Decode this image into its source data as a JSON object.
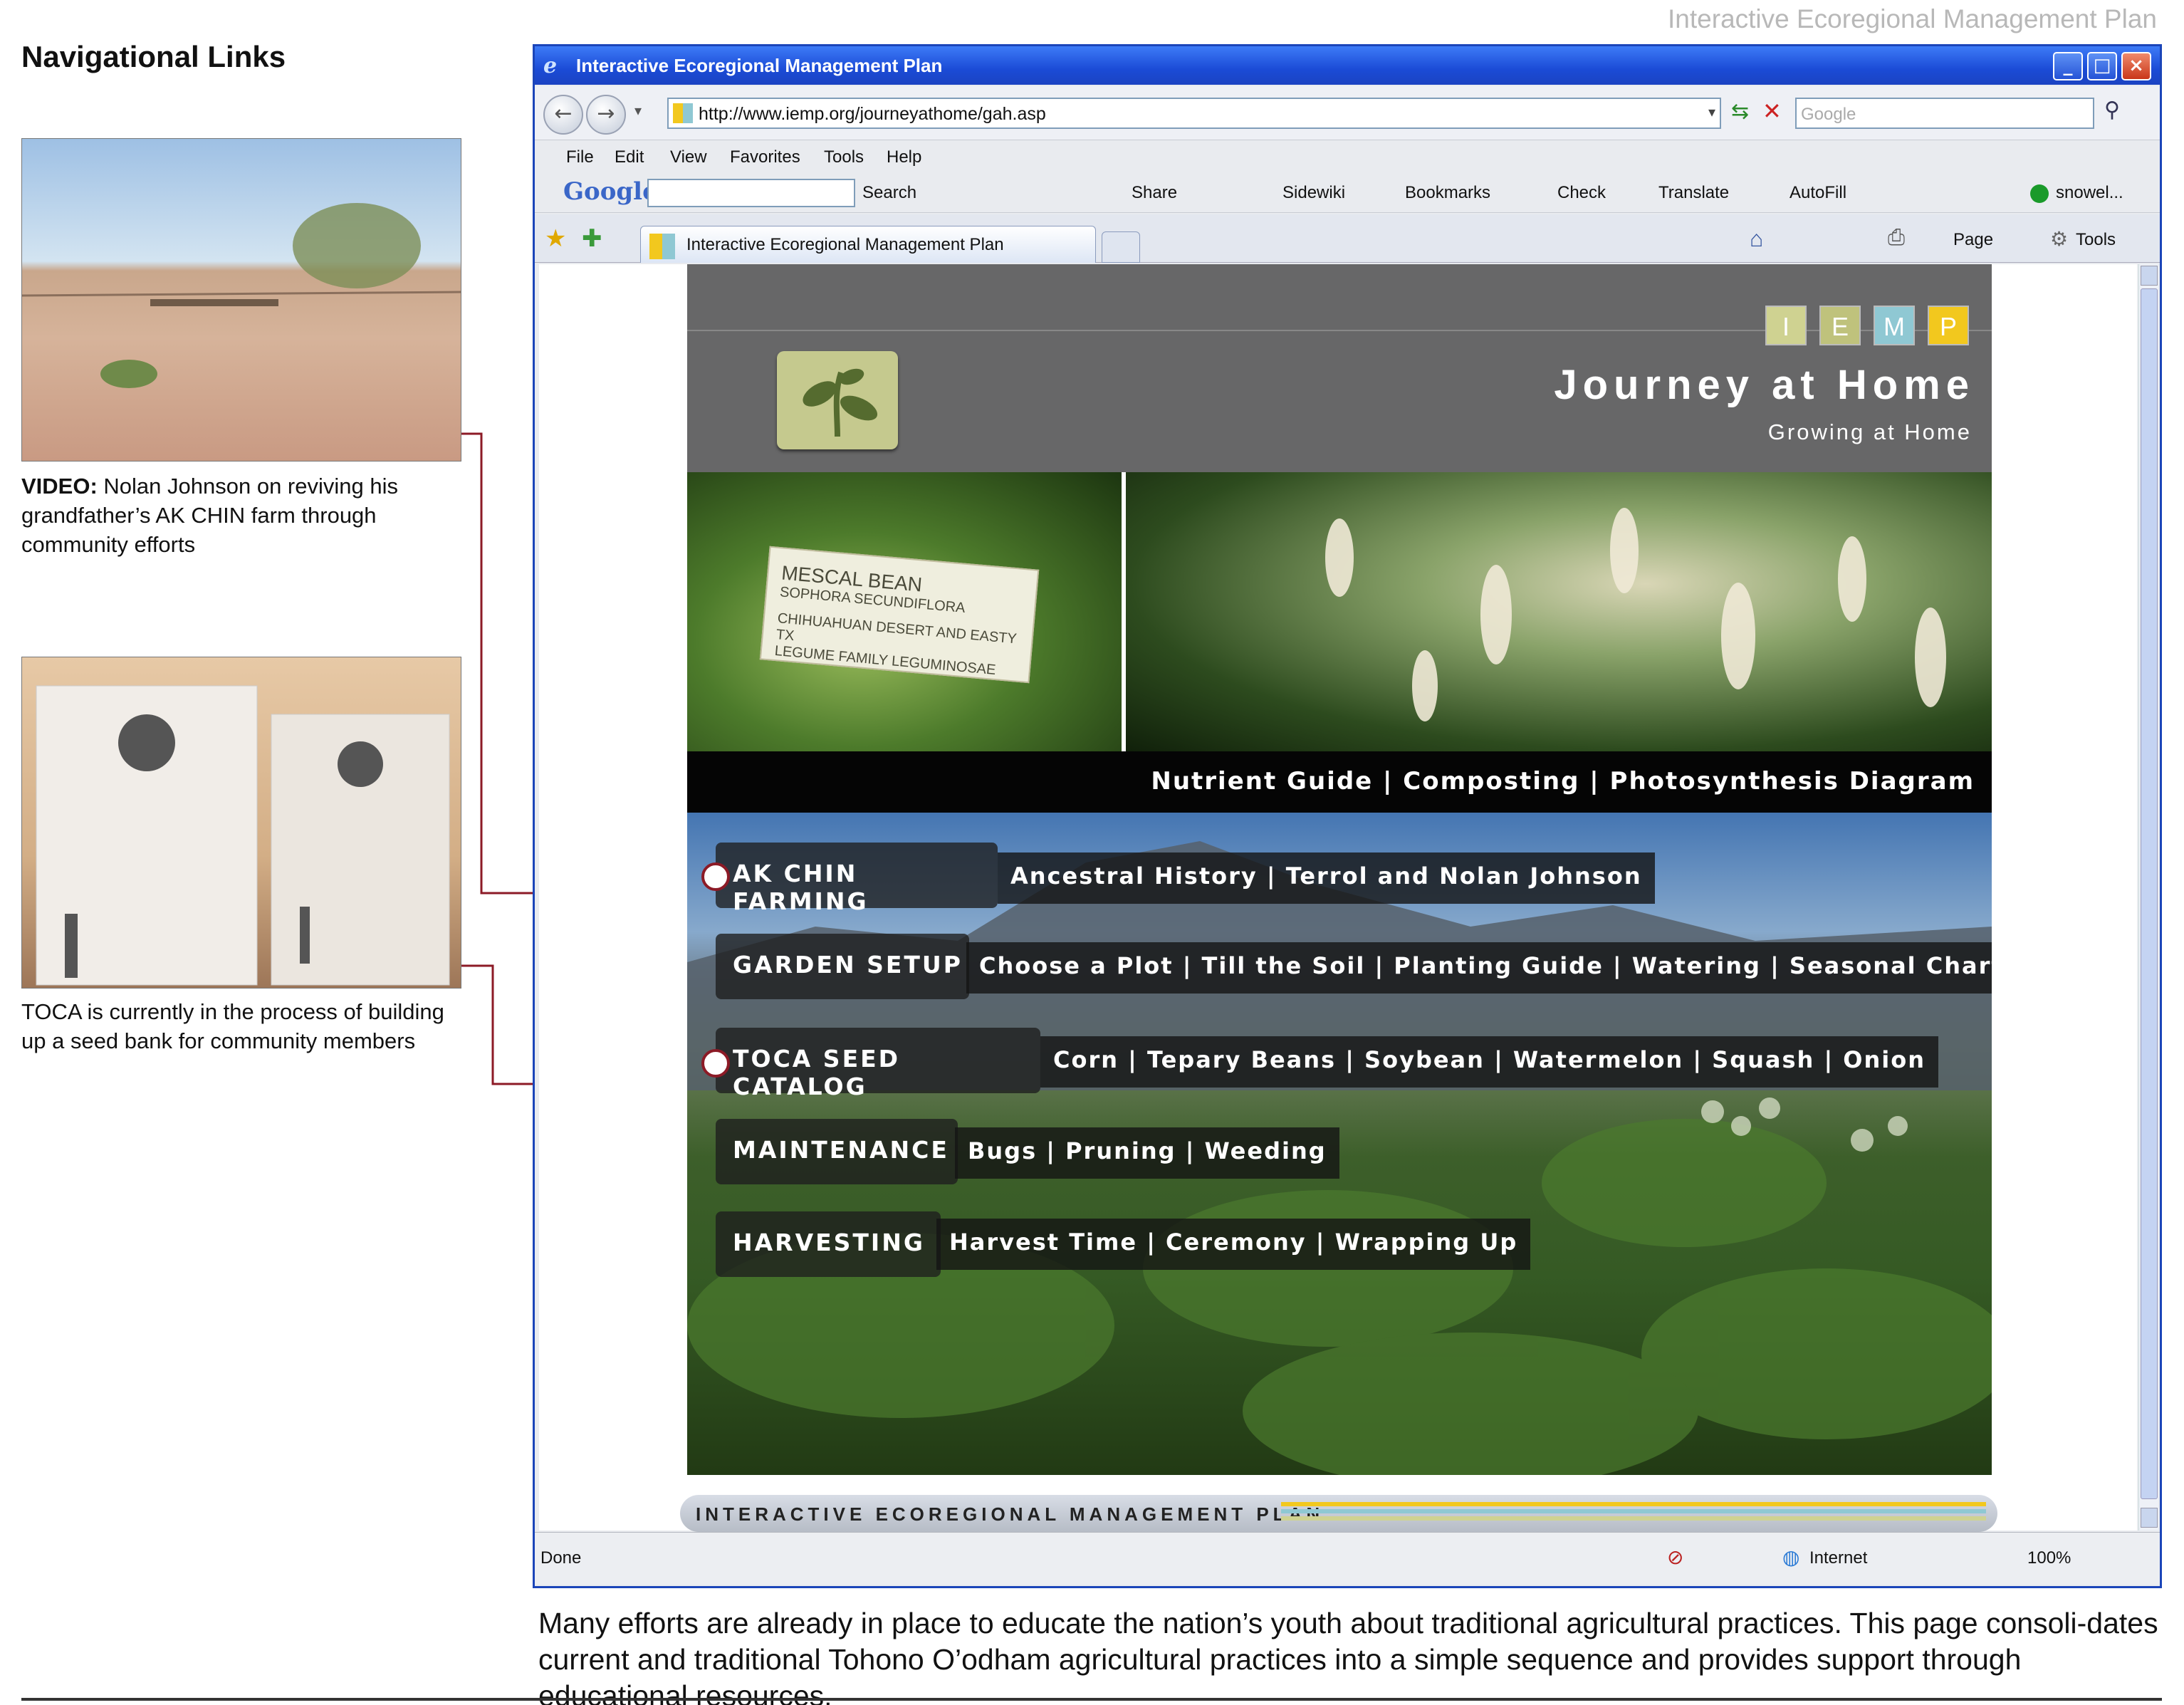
{
  "document": {
    "header": "Interactive Ecoregional Management Plan",
    "heading": "Navigational Links",
    "bottom_caption": "Many efforts are already in place to educate the nation’s youth about traditional agricultural practices. This page consoli-dates current and traditional Tohono O’odham agricultural practices into a simple sequence and provides support through educational resources."
  },
  "sidebar": {
    "video_caption_bold": "VIDEO:",
    "video_caption": " Nolan Johnson on reviving his grandfather’s AK CHIN farm through community efforts",
    "toca_caption": "TOCA is currently in the process of building up a seed bank for community members"
  },
  "browser": {
    "window_title": "Interactive Ecoregional Management Plan",
    "url": "http://www.iemp.org/journeyathome/gah.asp",
    "search_placeholder": "Google",
    "menu": [
      "File",
      "Edit",
      "View",
      "Favorites",
      "Tools",
      "Help"
    ],
    "google_toolbar": {
      "brand": "Google",
      "items": [
        "Search",
        "Share",
        "Sidewiki",
        "Bookmarks",
        "Check",
        "Translate",
        "AutoFill",
        "snowel..."
      ]
    },
    "tab_title": "Interactive Ecoregional Management Plan",
    "command_bar": {
      "page": "Page",
      "tools": "Tools"
    },
    "status": {
      "left": "Done",
      "zone": "Internet",
      "zoom": "100%"
    }
  },
  "site": {
    "logo_letters": [
      "I",
      "E",
      "M",
      "P"
    ],
    "logo_colors": [
      "#cfd291",
      "#bfc27c",
      "#8fc8d3",
      "#f2c81e"
    ],
    "title": "Journey at Home",
    "subtitle": "Growing at Home",
    "hero_sign": [
      "MESCAL BEAN",
      "SOPHORA SECUNDIFLORA",
      "CHIHUAHUAN DESERT AND EASTY TX",
      "LEGUME FAMILY   LEGUMINOSAE"
    ],
    "resources": "Nutrient Guide | Composting | Photosynthesis Diagram",
    "steps": [
      {
        "label": "AK CHIN FARMING",
        "links": "Ancestral History | Terrol and Nolan Johnson"
      },
      {
        "label": "GARDEN SETUP",
        "links": "Choose a Plot | Till the Soil | Planting Guide | Watering | Seasonal Chart"
      },
      {
        "label": "TOCA SEED CATALOG",
        "links": "Corn | Tepary Beans | Soybean | Watermelon | Squash | Onion"
      },
      {
        "label": "MAINTENANCE",
        "links": "Bugs | Pruning | Weeding"
      },
      {
        "label": "HARVESTING",
        "links": "Harvest Time | Ceremony | Wrapping Up"
      }
    ],
    "footer": "INTERACTIVE ECOREGIONAL MANAGEMENT PLAN"
  },
  "colors": {
    "connector": "#8c1a26",
    "titlebar": "#1b4bd6",
    "header_gray": "#676768"
  }
}
